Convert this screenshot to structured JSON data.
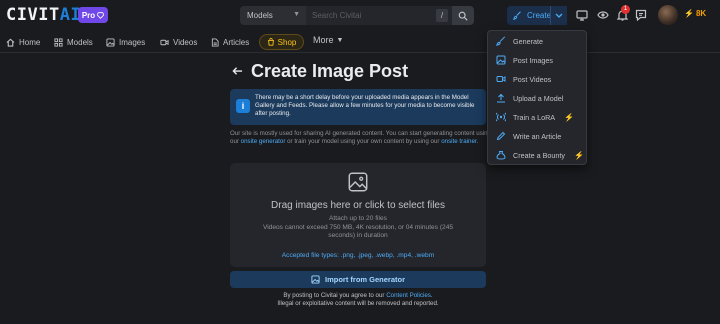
{
  "app": {
    "logo_main": "CIVIT",
    "logo_accent": "AI",
    "pro_label": "Pro"
  },
  "search": {
    "scope": "Models",
    "placeholder": "Search Civitai",
    "shortcut": "/"
  },
  "header": {
    "create_label": "Create",
    "notification_count": "1",
    "buzz_amount": "8K",
    "colors": {
      "accent": "#4dabf7",
      "brand": "#1c7ed6",
      "pro": "#7048e8",
      "buzz": "#f59f00"
    }
  },
  "nav": {
    "items": [
      {
        "label": "Home",
        "icon": "home-icon"
      },
      {
        "label": "Models",
        "icon": "grid-icon"
      },
      {
        "label": "Images",
        "icon": "photo-icon"
      },
      {
        "label": "Videos",
        "icon": "video-icon"
      },
      {
        "label": "Articles",
        "icon": "article-icon"
      }
    ],
    "shop_label": "Shop",
    "more_label": "More"
  },
  "page": {
    "title": "Create Image Post",
    "info": "There may be a short delay before your uploaded media appears in the Model Gallery and Feeds. Please allow a few minutes for your media to become visible after posting.",
    "notice_part1": "Our site is mostly used for sharing AI generated content. You can start generating content using our ",
    "notice_link1": "onsite generator",
    "notice_part2": " or train your model using your own content by using our ",
    "notice_link2": "onsite trainer",
    "notice_end": "."
  },
  "dropzone": {
    "title": "Drag images here or click to select files",
    "attach_limit": "Attach up to 20 files",
    "video_limit": "Videos cannot exceed 750 MB, 4K resolution, or 04 minutes (245 seconds) in duration",
    "accepted": "Accepted file types: .png, .jpeg, .webp, .mp4, .webm"
  },
  "import_button": "Import from Generator",
  "footer": {
    "prefix": "By posting to Civitai you agree to our ",
    "link": "Content Policies",
    "suffix": ".",
    "line2": "Illegal or exploitative content will be removed and reported."
  },
  "create_menu": {
    "items": [
      {
        "label": "Generate",
        "icon": "brush-icon"
      },
      {
        "label": "Post Images",
        "icon": "photo-icon"
      },
      {
        "label": "Post Videos",
        "icon": "video-icon"
      },
      {
        "label": "Upload a Model",
        "icon": "upload-icon"
      },
      {
        "label": "Train a LoRA",
        "icon": "antenna-icon"
      },
      {
        "label": "Write an Article",
        "icon": "pencil-icon"
      },
      {
        "label": "Create a Bounty",
        "icon": "moneybag-icon"
      }
    ]
  }
}
